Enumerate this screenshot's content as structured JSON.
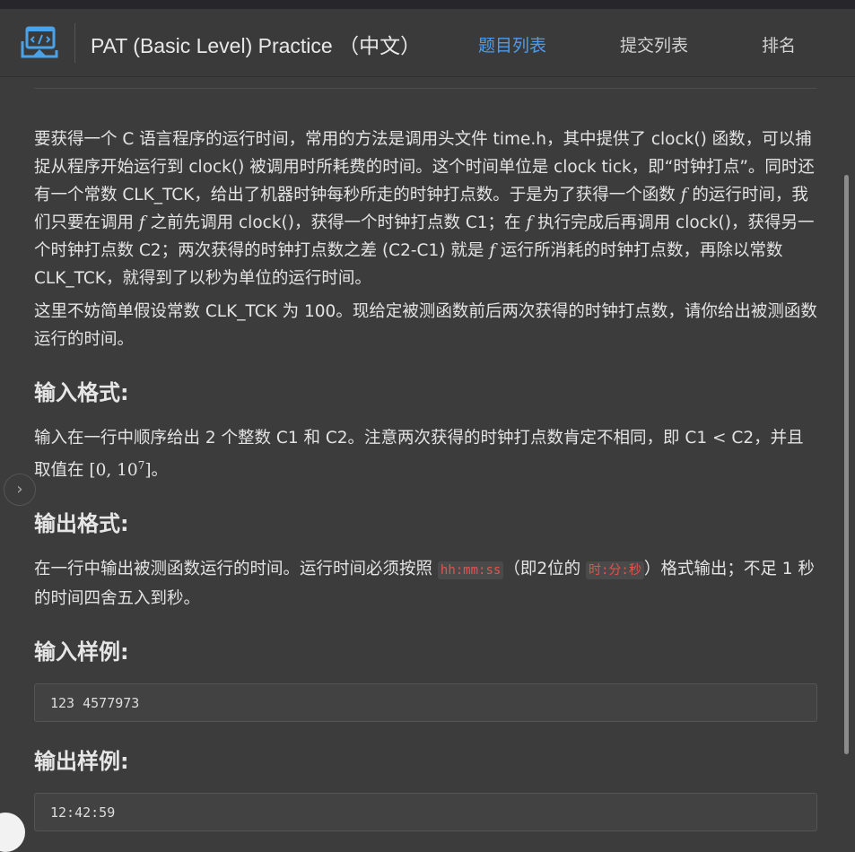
{
  "header": {
    "logo_icon": "code-window-icon",
    "title": "PAT (Basic Level) Practice （中文）",
    "nav": [
      {
        "label": "题目列表",
        "active": true
      },
      {
        "label": "提交列表",
        "active": false
      },
      {
        "label": "排名",
        "active": false
      }
    ]
  },
  "description": {
    "p1_a": "要获得一个 C 语言程序的运行时间，常用的方法是调用头文件 time.h，其中提供了 clock() 函数，可以捕捉从程序开始运行到 clock() 被调用时所耗费的时间。这个时间单位是 clock tick，即“时钟打点”。同时还有一个常数 CLK_TCK，给出了机器时钟每秒所走的时钟打点数。于是为了获得一个函数 ",
    "p1_b": " 的运行时间，我们只要在调用 ",
    "p1_c": " 之前先调用 clock()，获得一个时钟打点数 C1；在 ",
    "p1_d": " 执行完成后再调用 clock()，获得另一个时钟打点数 C2；两次获得的时钟打点数之差 (C2-C1) 就是 ",
    "p1_e": " 运行所消耗的时钟打点数，再除以常数 CLK_TCK，就得到了以秒为单位的运行时间。",
    "math_f": "f",
    "p2": "这里不妨简单假设常数 CLK_TCK 为 100。现给定被测函数前后两次获得的时钟打点数，请你给出被测函数运行的时间。"
  },
  "input_format": {
    "heading": "输入格式:",
    "text_a": "输入在一行中顺序给出 2 个整数 C1 和 C2。注意两次获得的时钟打点数肯定不相同，即 C1 ",
    "lt": "<",
    "text_b": " C2，并且取值在 ",
    "range_start": "[0, 10",
    "range_exp": "7",
    "range_end": "]",
    "text_c": "。"
  },
  "output_format": {
    "heading": "输出格式:",
    "text_a": "在一行中输出被测函数运行的时间。运行时间必须按照 ",
    "code1": "hh:mm:ss",
    "text_b": "（即2位的 ",
    "code2": "时:分:秒",
    "text_c": "）格式输出；不足 1 秒的时间四舍五入到秒。"
  },
  "sample_input": {
    "heading": "输入样例:",
    "code": "123 4577973"
  },
  "sample_output": {
    "heading": "输出样例:",
    "code": "12:42:59"
  },
  "side_toggle_icon": "chevron-right-icon",
  "colors": {
    "accent": "#4a9cf0",
    "background": "#3c3c3c",
    "inline_code": "#e5534b"
  }
}
